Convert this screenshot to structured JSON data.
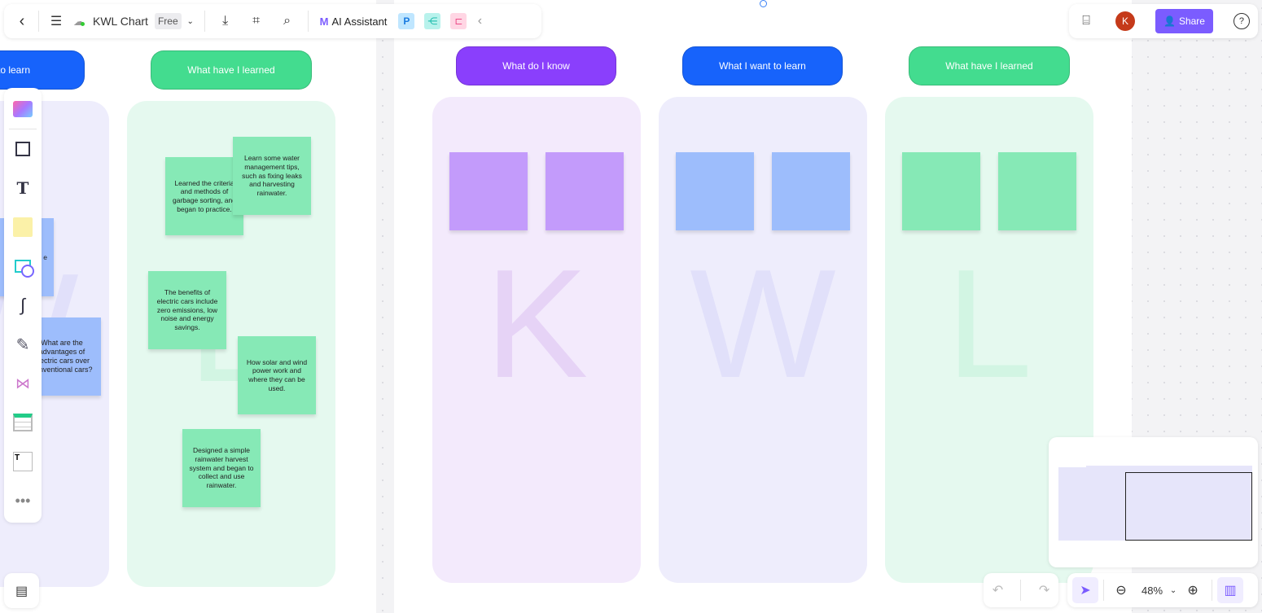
{
  "toolbar": {
    "title": "KWL Chart",
    "plan_badge": "Free",
    "ai_label": "AI Assistant",
    "share_label": "Share",
    "avatar_letter": "K"
  },
  "left_frame": {
    "headers": [
      {
        "label": "What I want to learn",
        "visible_label": "ant to learn",
        "color": "#1763fb"
      },
      {
        "label": "What have I learned",
        "color": "#43dc8f"
      }
    ],
    "blue_notes": [
      "e",
      "What are the advantages of electric cars over conventional cars?"
    ],
    "green_notes": [
      "Learned the criteria and methods of garbage sorting, and began to practice.",
      "Learn some water management tips, such as fixing leaks and harvesting rainwater.",
      "The benefits of electric cars include zero emissions, low noise and energy savings.",
      "How solar and wind power work and where they can be used.",
      "Designed a simple rainwater harvest system and began to collect and use rainwater."
    ]
  },
  "main_frame": {
    "columns": [
      {
        "header": "What do I know",
        "letter": "K",
        "header_color": "#8a3ffc",
        "bg": "#f3eafc",
        "note_color": "#c39bfb",
        "letter_color": "#e6d3f6"
      },
      {
        "header": "What I want to learn",
        "letter": "W",
        "header_color": "#1763fb",
        "bg": "#eeedfc",
        "note_color": "#9dbdfc",
        "letter_color": "#e1e0fa"
      },
      {
        "header": "What have I learned",
        "letter": "L",
        "header_color": "#43dc8f",
        "bg": "#e5f9ef",
        "note_color": "#86e9b6",
        "letter_color": "#d2f5e3"
      }
    ]
  },
  "zoom": {
    "level": "48%"
  }
}
